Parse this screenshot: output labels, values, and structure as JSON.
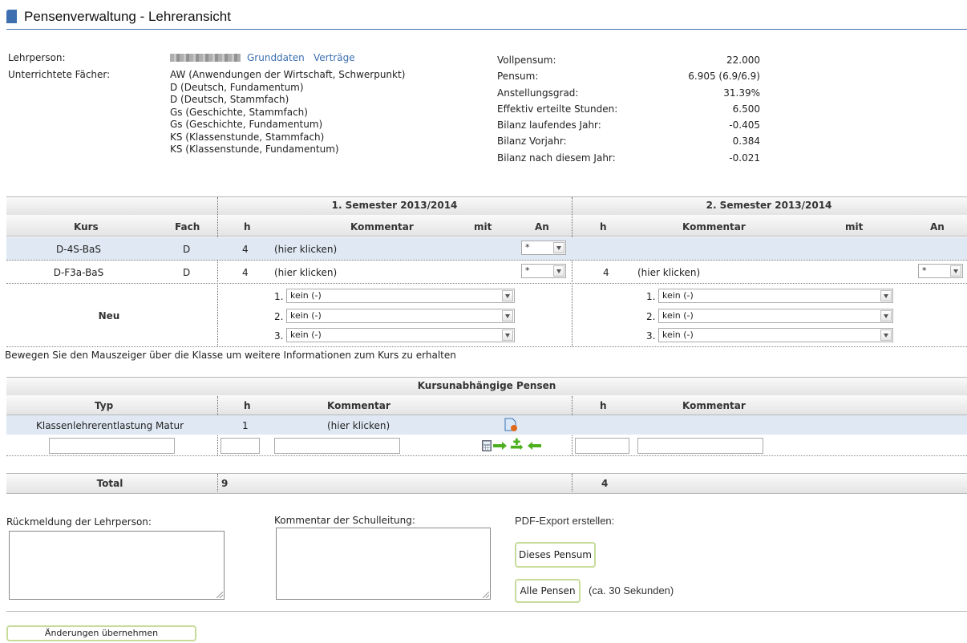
{
  "page": {
    "title": "Pensenverwaltung - Lehreransicht"
  },
  "teacher": {
    "label_person": "Lehrperson:",
    "link_grunddaten": "Grunddaten",
    "link_vertraege": "Verträge",
    "label_subjects": "Unterrichtete Fächer:",
    "subjects": [
      "AW (Anwendungen der Wirtschaft, Schwerpunkt)",
      "D (Deutsch, Fundamentum)",
      "D (Deutsch, Stammfach)",
      "Gs (Geschichte, Stammfach)",
      "Gs (Geschichte, Fundamentum)",
      "KS (Klassenstunde, Stammfach)",
      "KS (Klassenstunde, Fundamentum)"
    ]
  },
  "stats": [
    {
      "label": "Vollpensum:",
      "value": "22.000"
    },
    {
      "label": "Pensum:",
      "value": "6.905 (6.9/6.9)"
    },
    {
      "label": "Anstellungsgrad:",
      "value": "31.39%"
    },
    {
      "label": "Effektiv erteilte Stunden:",
      "value": "6.500"
    },
    {
      "label": "Bilanz laufendes Jahr:",
      "value": "-0.405"
    },
    {
      "label": "Bilanz Vorjahr:",
      "value": "0.384"
    },
    {
      "label": "Bilanz nach diesem Jahr:",
      "value": "-0.021"
    }
  ],
  "courses": {
    "sem1_title": "1. Semester 2013/2014",
    "sem2_title": "2. Semester 2013/2014",
    "col_kurs": "Kurs",
    "col_fach": "Fach",
    "col_h": "h",
    "col_kommentar": "Kommentar",
    "col_mit": "mit",
    "col_an": "An",
    "rows": [
      {
        "kurs": "D-4S-BaS",
        "fach": "D",
        "h1": "4",
        "k1": "(hier klicken)",
        "an1": "*",
        "h2": "",
        "k2": "",
        "an2": ""
      },
      {
        "kurs": "D-F3a-BaS",
        "fach": "D",
        "h1": "4",
        "k1": "(hier klicken)",
        "an1": "*",
        "h2": "4",
        "k2": "(hier klicken)",
        "an2": "*"
      }
    ],
    "new_label": "Neu",
    "new_selects": [
      {
        "num": "1.",
        "value": "kein (-)"
      },
      {
        "num": "2.",
        "value": "kein (-)"
      },
      {
        "num": "3.",
        "value": "kein (-)"
      }
    ],
    "hint": "Bewegen Sie den Mauszeiger über die Klasse um weitere Informationen zum Kurs zu erhalten"
  },
  "independent": {
    "title": "Kursunabhängige Pensen",
    "col_typ": "Typ",
    "col_h": "h",
    "col_kommentar": "Kommentar",
    "row": {
      "typ": "Klassenlehrerentlastung Matur",
      "h": "1",
      "kommentar": "(hier klicken)"
    }
  },
  "total": {
    "label": "Total",
    "sem1": "9",
    "sem2": "4"
  },
  "feedback": {
    "teacher_label": "Rückmeldung der Lehrperson:",
    "school_label": "Kommentar der Schulleitung:",
    "pdf_label": "PDF-Export erstellen:",
    "btn_this": "Dieses Pensum",
    "btn_all": "Alle Pensen",
    "all_note": "(ca. 30 Sekunden)"
  },
  "apply_button": "Änderungen übernehmen",
  "colors": {
    "accent": "#3d6fb0",
    "row_highlight": "#dfe8f3",
    "button_border": "#c7dc9a"
  }
}
